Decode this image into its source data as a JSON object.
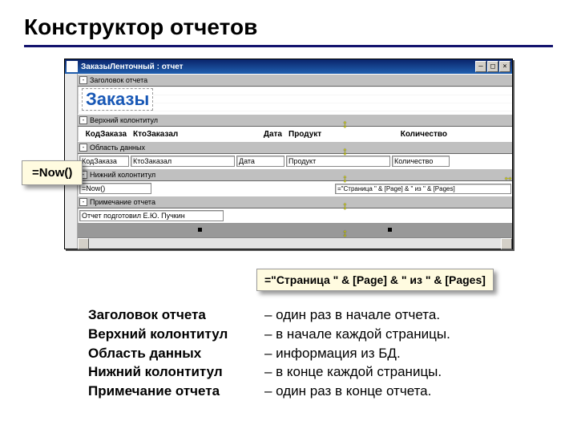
{
  "title": "Конструктор отчетов",
  "window": {
    "title": "ЗаказыЛенточный : отчет",
    "close": "×",
    "max": "□",
    "min": "—"
  },
  "sections": {
    "header": "Заголовок отчета",
    "page_header": "Верхний колонтитул",
    "detail": "Область данных",
    "page_footer": "Нижний колонтитул",
    "footer": "Примечание отчета"
  },
  "report_title": "Заказы",
  "headers": {
    "col1": "КодЗаказа",
    "col2": "КтоЗаказал",
    "col3": "Дата",
    "col4": "Продукт",
    "col5": "Количество"
  },
  "fields": {
    "col1": "КодЗаказа",
    "col2": "КтоЗаказал",
    "col3": "Дата",
    "col4": "Продукт",
    "col5": "Количество"
  },
  "footer_now": "=Now()",
  "footer_page": "=\"Страница \" & [Page] & \" из \" & [Pages]",
  "credits": "Отчет подготовил Е.Ю. Пучкин",
  "callout1": "=Now()",
  "callout2": "=\"Страница \" & [Page] & \" из \" & [Pages]",
  "desc": {
    "t1": "Заголовок отчета",
    "d1": "– один раз в начале отчета.",
    "t2": "Верхний колонтитул",
    "d2": "– в начале каждой страницы.",
    "t3": "Область данных",
    "d3": "– информация из БД.",
    "t4": "Нижний колонтитул",
    "d4": "– в конце каждой страницы.",
    "t5": "Примечание отчета",
    "d5": "– один раз в конце отчета."
  },
  "toggle": "-"
}
